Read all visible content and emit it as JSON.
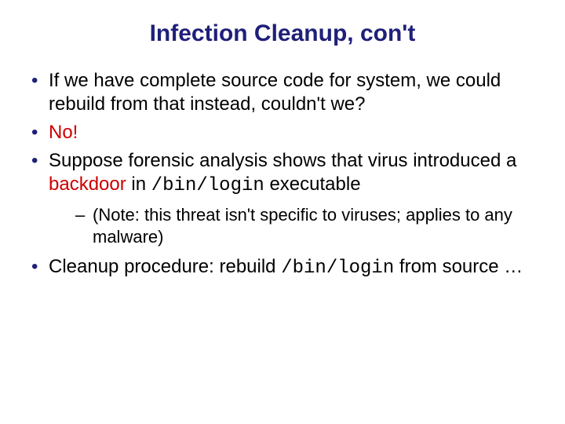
{
  "title": "Infection Cleanup, con't",
  "b1_a": "If we have complete source code for system, we could rebuild from that instead, couldn't we?",
  "b2_a": "No!",
  "b3_a": "Suppose forensic analysis shows that virus introduced a ",
  "b3_b": "backdoor",
  "b3_c": " in ",
  "b3_d": "/bin/login",
  "b3_e": " executable",
  "s1_a": "(Note: this threat isn't specific to viruses; applies to any malware)",
  "b4_a": "Cleanup procedure: rebuild ",
  "b4_b": "/bin/login",
  "b4_c": " from source …"
}
